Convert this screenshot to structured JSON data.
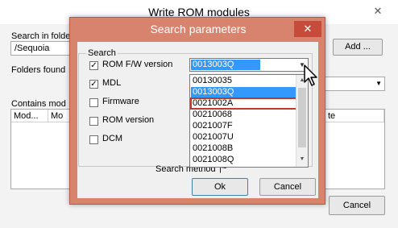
{
  "outer": {
    "title": "Write ROM modules",
    "search_in_label": "Search in folde",
    "search_in_value": "/Sequoia",
    "add_button": "Add ...",
    "folders_found_label": "Folders found",
    "contains_label": "Contains mod",
    "columns": [
      "Mod...",
      "Mo",
      "te"
    ],
    "cancel_button": "Cancel"
  },
  "dialog": {
    "title": "Search parameters",
    "group_label": "Search",
    "checkboxes": [
      {
        "label": "ROM F/W version",
        "checked": true
      },
      {
        "label": "MDL",
        "checked": true
      },
      {
        "label": "Firmware",
        "checked": false
      },
      {
        "label": "ROM version",
        "checked": false
      },
      {
        "label": "DCM",
        "checked": false
      }
    ],
    "dropdown": {
      "selected": "0013003Q",
      "options": [
        "00130035",
        "0013003Q",
        "0021002A",
        "00210068",
        "0021007F",
        "0021007U",
        "0021008B",
        "0021008Q"
      ],
      "highlighted_index": 1,
      "boxed_index": 2
    },
    "search_method_label": "Search method",
    "search_method_value": "|~",
    "ok_button": "Ok",
    "cancel_button": "Cancel"
  },
  "colors": {
    "dialog_frame": "#d8836e",
    "close_button": "#c74b3a",
    "selection": "#3399ff",
    "annotation_box": "#c0392b"
  }
}
